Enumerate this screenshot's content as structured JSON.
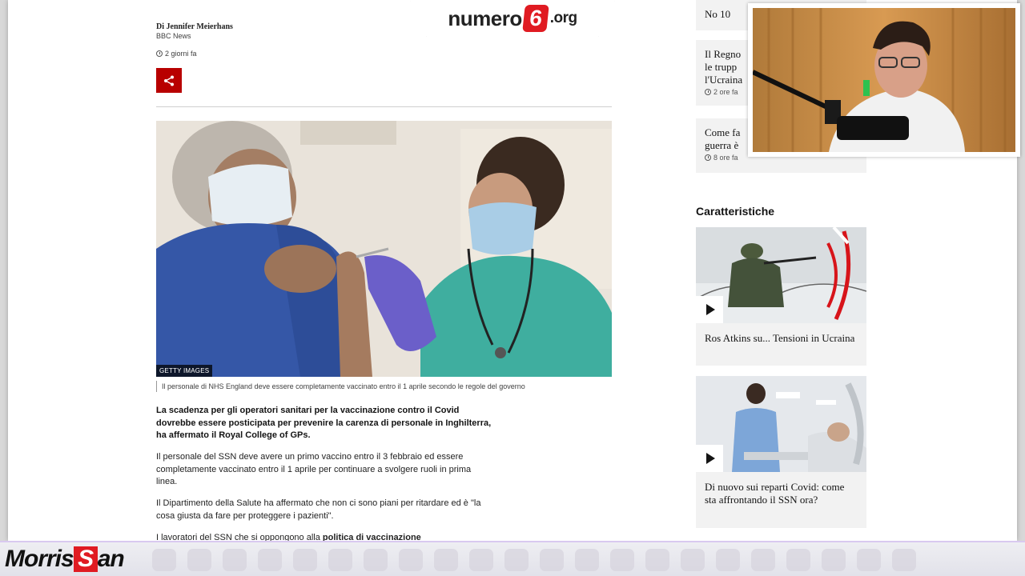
{
  "article": {
    "author": "Di Jennifer Meierhans",
    "source": "BBC News",
    "timestamp": "2 giorni fa",
    "image_credit": "GETTY IMAGES",
    "caption": "Il personale di NHS England deve essere completamente vaccinato entro il 1 aprile secondo le regole del governo",
    "paragraphs": [
      "La scadenza per gli operatori sanitari per la vaccinazione contro il Covid dovrebbe essere posticipata per prevenire la carenza di personale in Inghilterra, ha affermato il Royal College of GPs.",
      "Il personale del SSN deve avere un primo vaccino entro il 3 febbraio ed essere completamente vaccinato entro il 1 aprile per continuare a svolgere ruoli in prima linea.",
      "Il Dipartimento della Salute ha affermato che non ci sono piani per ritardare ed è \"la cosa giusta da fare per proteggere i pazienti\"."
    ],
    "partial_para_start": "I lavoratori del SSN che si oppongono alla ",
    "partial_para_bold": "politica di vaccinazione"
  },
  "rail": {
    "cards": [
      {
        "title": "No 10",
        "time": ""
      },
      {
        "title": "Il Regno Unito invia le truppe... l'Ucraina",
        "title_lines": [
          "Il Regno",
          "le trupp",
          "l'Ucraina"
        ],
        "time": "2 ore fa"
      },
      {
        "title_lines": [
          "Come fa",
          "guerra è"
        ],
        "time": "8 ore fa"
      }
    ],
    "section_heading": "Caratteristiche",
    "features": [
      {
        "title": "Ros Atkins su... Tensioni in Ucraina"
      },
      {
        "title": "Di nuovo sui reparti Covid: come sta affrontando il SSN ora?"
      }
    ]
  },
  "overlay": {
    "logo_prefix": "numero",
    "logo_number": "6",
    "logo_tld": ".org",
    "brand_prefix": "Morris",
    "brand_letter": "S",
    "brand_suffix": "an"
  },
  "colors": {
    "bbc_red": "#b80000",
    "logo_red": "#e01b22",
    "card_bg": "#f2f2f2"
  }
}
